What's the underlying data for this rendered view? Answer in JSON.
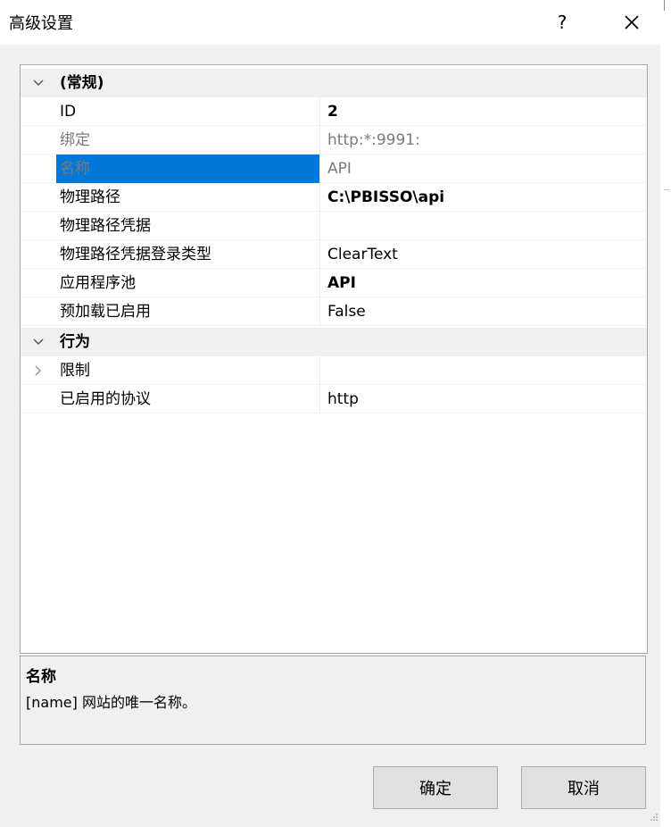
{
  "window": {
    "title": "高级设置",
    "help_label": "?"
  },
  "grid": {
    "categories": [
      {
        "label": "(常规)",
        "expanded": true,
        "properties": [
          {
            "name": "ID",
            "value": "2",
            "bold": true
          },
          {
            "name": "绑定",
            "value": "http:*:9991:",
            "readonly": true
          },
          {
            "name": "名称",
            "value": "API",
            "selected": true,
            "readonly": true
          },
          {
            "name": "物理路径",
            "value": "C:\\PBISSO\\api",
            "bold": true
          },
          {
            "name": "物理路径凭据",
            "value": ""
          },
          {
            "name": "物理路径凭据登录类型",
            "value": "ClearText"
          },
          {
            "name": "应用程序池",
            "value": "API",
            "bold": true
          },
          {
            "name": "预加载已启用",
            "value": "False"
          }
        ]
      },
      {
        "label": "行为",
        "expanded": true,
        "properties": [
          {
            "name": "限制",
            "value": "",
            "collapsed_group": true
          },
          {
            "name": "已启用的协议",
            "value": "http"
          }
        ]
      }
    ]
  },
  "description": {
    "title": "名称",
    "text": "[name] 网站的唯一名称。"
  },
  "buttons": {
    "ok": "确定",
    "cancel": "取消"
  },
  "colors": {
    "selection": "#0078d7",
    "category_bg": "#f0f0f0",
    "dialog_bg": "#f0f0f0"
  }
}
